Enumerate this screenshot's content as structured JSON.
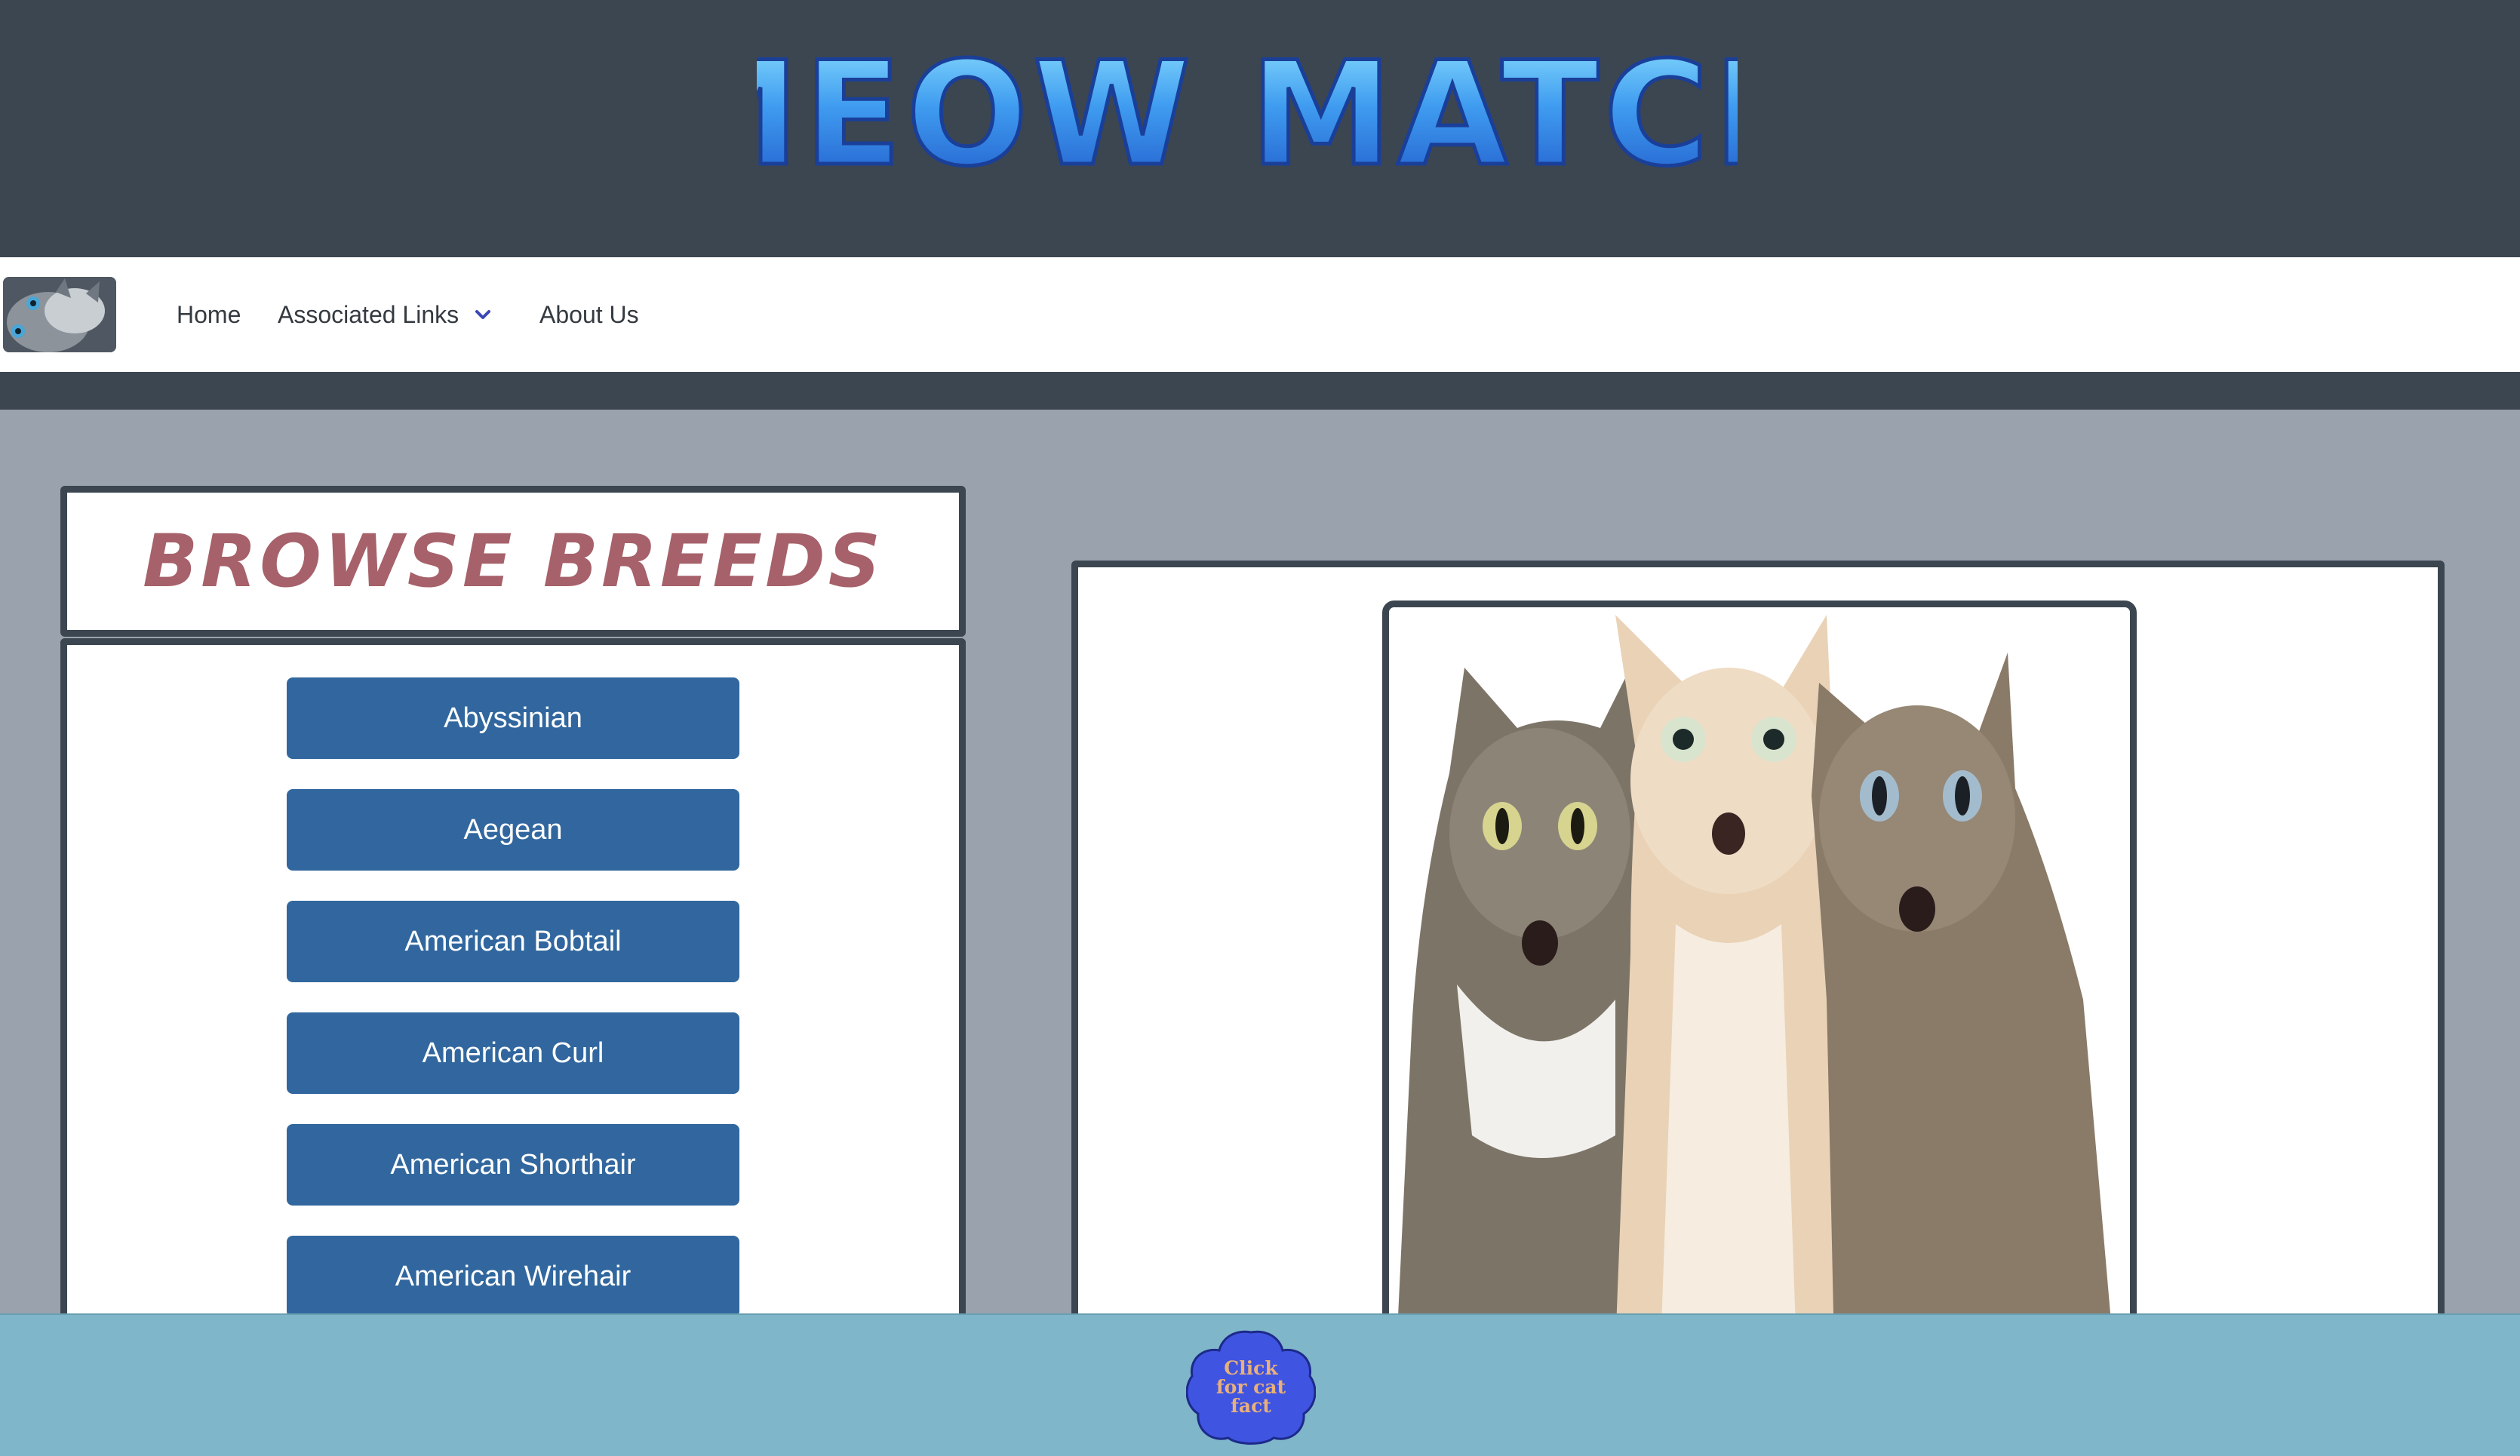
{
  "header": {
    "logo_text": "MEOW MATCH"
  },
  "nav": {
    "avatar_icon": "cat-avatar-icon",
    "links": [
      {
        "label": "Home"
      },
      {
        "label": "Associated Links",
        "icon": "chevron-down-icon"
      },
      {
        "label": "About Us"
      }
    ]
  },
  "browse": {
    "title": "Browse Breeds",
    "breeds": [
      "Abyssinian",
      "Aegean",
      "American Bobtail",
      "American Curl",
      "American Shorthair",
      "American Wirehair"
    ]
  },
  "footer": {
    "fact_button_label": "Click for cat fact"
  },
  "colors": {
    "header_bg": "#3c4650",
    "page_bg": "#9aa2ad",
    "breed_button": "#31679e",
    "title_color": "#a6616a",
    "footer_bg": "#7fb6c9",
    "fact_button": "#3f54e0"
  }
}
